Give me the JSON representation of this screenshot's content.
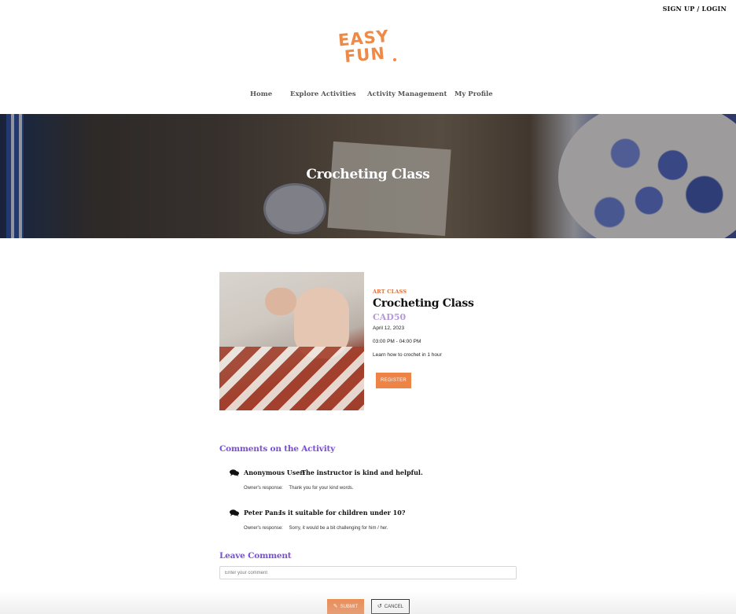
{
  "header": {
    "login_link": "SIGN UP / LOGIN",
    "logo": {
      "line1": "EASY",
      "line2": "FUN",
      "dot": ".",
      "color": "#ee8a46"
    }
  },
  "nav": {
    "items": [
      {
        "label": "Home"
      },
      {
        "label": "Explore Activities"
      },
      {
        "label": "Activity Management"
      },
      {
        "label": "My Profile"
      }
    ]
  },
  "hero": {
    "title": "Crocheting Class"
  },
  "activity": {
    "category": "ART CLASS",
    "title": "Crocheting Class",
    "price": "CAD50",
    "date": "April 12, 2023",
    "time": "03:00 PM - 04:00 PM",
    "description": "Learn how to crochet in 1 hour",
    "register_label": "REGISTER"
  },
  "comments": {
    "heading": "Comments on the Activity",
    "items": [
      {
        "author": "Anonymous User:",
        "text": "The instructor is kind and helpful.",
        "response_label": "Owner's response:",
        "response": "Thank you for your kind words."
      },
      {
        "author": "Peter Pan:",
        "text": "Is it suitable for children under 10?",
        "response_label": "Owner's response:",
        "response": "Sorry, it would be a bit challenging for him / her."
      }
    ]
  },
  "leave_comment": {
    "heading": "Leave Comment",
    "placeholder": "Enter your comment",
    "submit_label": "SUBMIT",
    "cancel_label": "CANCEL"
  },
  "colors": {
    "accent_orange": "#ee8346",
    "heading_purple": "#7a4fd6",
    "price_lavender": "#b59ad8"
  }
}
